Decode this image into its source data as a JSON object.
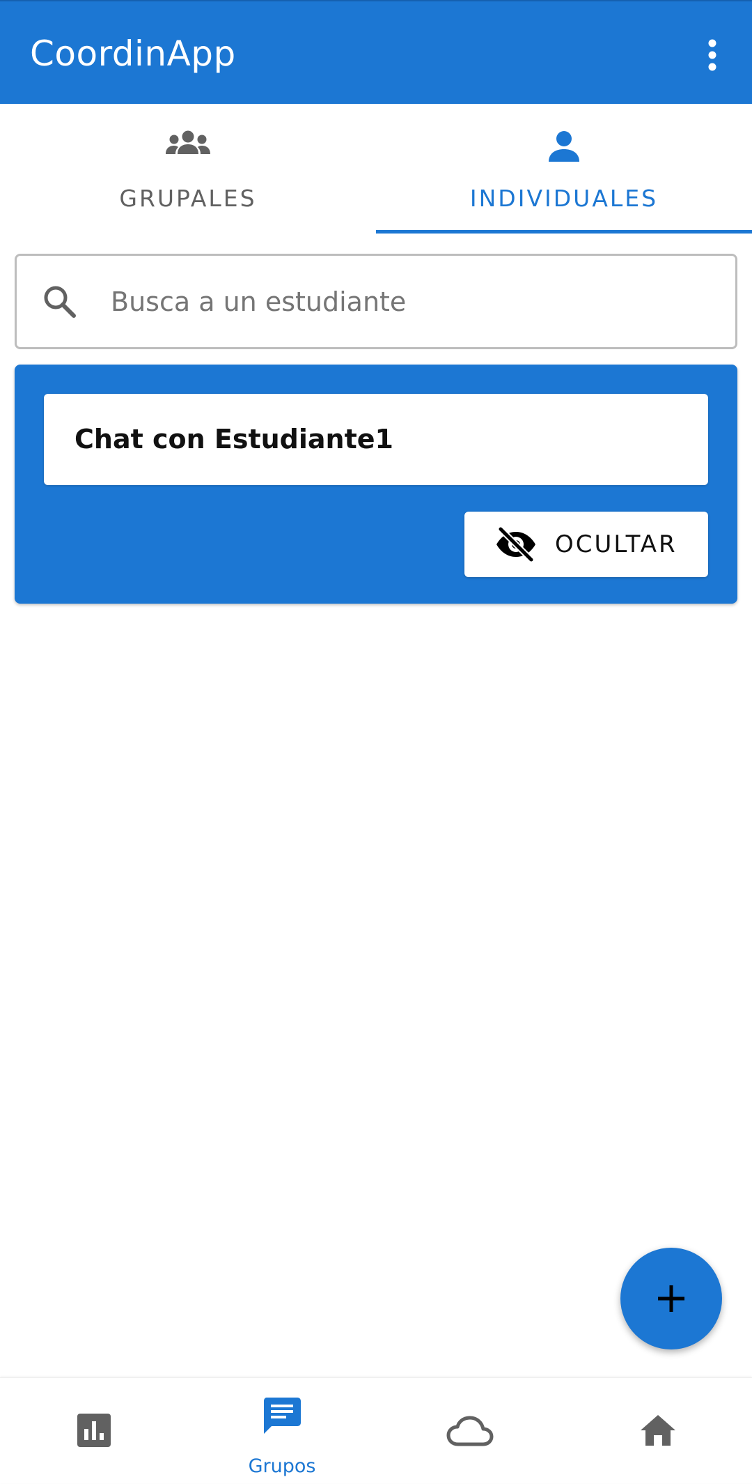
{
  "app_bar": {
    "title": "CoordinApp",
    "menu_icon": "more-vert-icon"
  },
  "tabs": [
    {
      "label": "GRUPALES",
      "icon": "group-icon",
      "active": false
    },
    {
      "label": "INDIVIDUALES",
      "icon": "person-icon",
      "active": true
    }
  ],
  "search": {
    "placeholder": "Busca a un estudiante",
    "value": "",
    "icon": "search-icon"
  },
  "chat_card": {
    "title": "Chat con Estudiante1",
    "hide_button_label": "OCULTAR",
    "hide_icon": "visibility-off-icon"
  },
  "fab": {
    "icon": "add-icon"
  },
  "bottom_nav": {
    "items": [
      {
        "icon": "bar-chart-icon",
        "label": "",
        "active": false
      },
      {
        "icon": "chat-icon",
        "label": "Grupos",
        "active": true
      },
      {
        "icon": "cloud-icon",
        "label": "",
        "active": false
      },
      {
        "icon": "home-icon",
        "label": "",
        "active": false
      }
    ]
  },
  "colors": {
    "primary": "#1c77d3",
    "inactive_gray": "#616161",
    "background": "#ffffff"
  }
}
